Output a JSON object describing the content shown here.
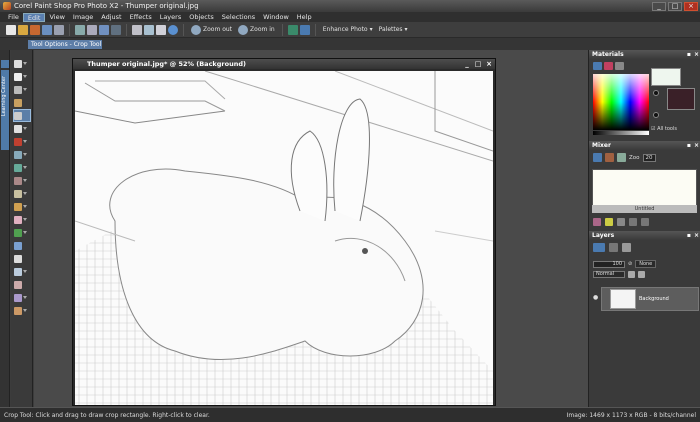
{
  "app": {
    "title": "Corel Paint Shop Pro Photo X2 - Thumper original.jpg"
  },
  "menu": [
    "File",
    "Edit",
    "View",
    "Image",
    "Adjust",
    "Effects",
    "Layers",
    "Objects",
    "Selections",
    "Window",
    "Help"
  ],
  "menu_active_index": 1,
  "toolbar": {
    "zoom_out_label": "Zoom out",
    "zoom_in_label": "Zoom in",
    "enhance_photo_label": "Enhance Photo",
    "palettes_label": "Palettes"
  },
  "tool_options": {
    "tab_label": "Tool Options - Crop Tool"
  },
  "left_strip": {
    "vertical_label": "Learning Center"
  },
  "document": {
    "title": "Thumper original.jpg* @ 52% (Background)"
  },
  "materials": {
    "title": "Materials",
    "all_tools_label": "All tools",
    "foreground_color": "#eef6ee",
    "background_color": "#3a2028"
  },
  "mixer": {
    "title": "Mixer",
    "zoom_label": "Zoo",
    "zoom_value": "20",
    "canvas_label": "Untitled"
  },
  "layers": {
    "title": "Layers",
    "opacity": "100",
    "mask_label": "None",
    "blend_mode": "Normal",
    "layer_name": "Background"
  },
  "status": {
    "hint": "Crop Tool: Click and drag to draw crop rectangle. Right-click to clear.",
    "image_info": "Image: 1469 x 1173 x RGB - 8 bits/channel"
  },
  "colors": {
    "accent": "#5d7ea8",
    "menu_highlight": "#5a7fb0"
  }
}
